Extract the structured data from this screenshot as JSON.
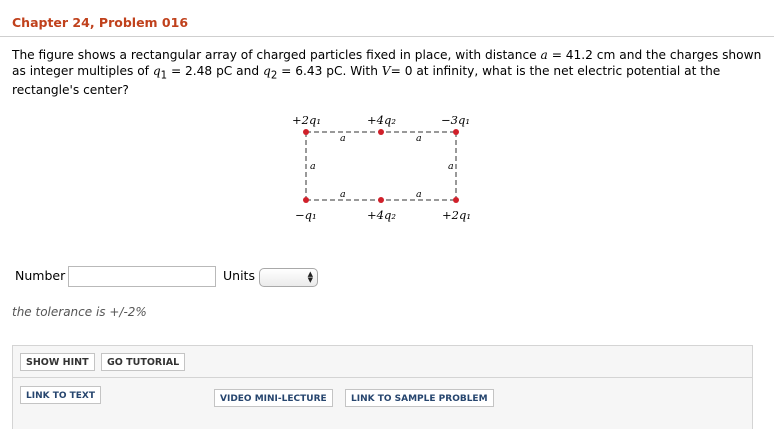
{
  "header": {
    "title": "Chapter 24, Problem 016"
  },
  "problem": {
    "p1": "The figure shows a rectangular array of charged particles fixed in place, with distance ",
    "var_a": "a",
    "p2": " = 41.2 cm and the charges shown as integer multiples of ",
    "var_q": "q",
    "sub1": "1",
    "p3": " = 2.48 pC and ",
    "sub2": "2",
    "p4": " = 6.43 pC. With ",
    "var_V": "V",
    "p5": "= 0 at infinity, what is the net electric potential at the rectangle's center?"
  },
  "figure": {
    "charges": {
      "top_left": "+2q₁",
      "top_mid": "+4q₂",
      "top_right": "−3q₁",
      "bottom_left": "−q₁",
      "bottom_mid": "+4q₂",
      "bottom_right": "+2q₁"
    },
    "distance_label": "a",
    "charge_color": "#d0202a"
  },
  "answer": {
    "number_label": "Number",
    "number_value": "",
    "units_label": "Units",
    "units_value": ""
  },
  "tolerance": "the tolerance is +/-2%",
  "buttons": {
    "show_hint": "SHOW HINT",
    "go_tutorial": "GO TUTORIAL",
    "link_to_text": "LINK TO TEXT",
    "video_mini_lecture": "VIDEO MINI-LECTURE",
    "link_to_sample": "LINK TO SAMPLE PROBLEM"
  }
}
